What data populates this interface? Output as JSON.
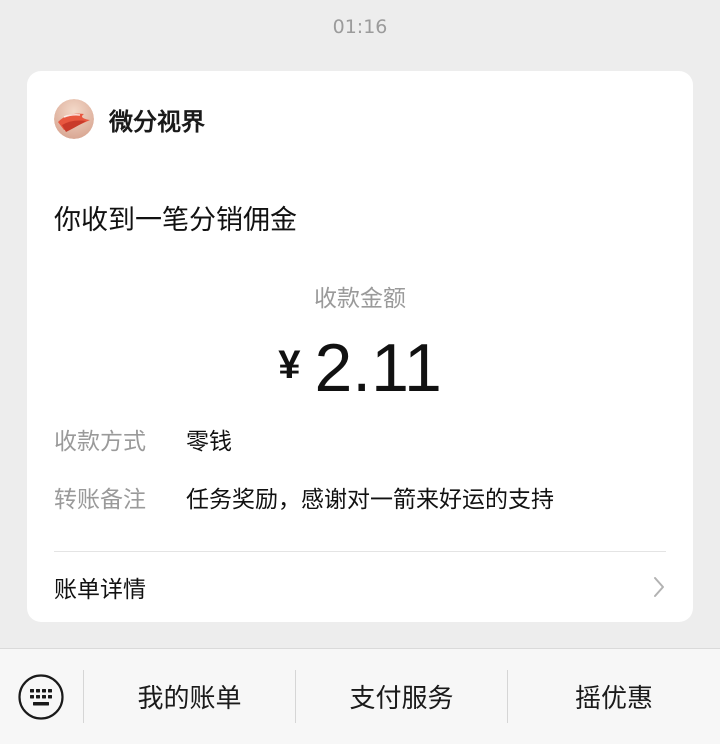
{
  "timestamp": "01:16",
  "card": {
    "merchant_name": "微分视界",
    "title": "你收到一笔分销佣金",
    "amount_label": "收款金额",
    "currency": "¥",
    "amount": "2.11",
    "rows": [
      {
        "label": "收款方式",
        "value": "零钱"
      },
      {
        "label": "转账备注",
        "value": "任务奖励，感谢对一箭来好运的支持"
      }
    ],
    "detail_label": "账单详情"
  },
  "bottom_bar": {
    "keyboard_icon": "keyboard-icon",
    "buttons": [
      "我的账单",
      "支付服务",
      "摇优惠"
    ]
  },
  "colors": {
    "background": "#ededed",
    "card": "#ffffff",
    "muted_text": "#9a9a9a",
    "avatar_accent": "#e8573f"
  }
}
